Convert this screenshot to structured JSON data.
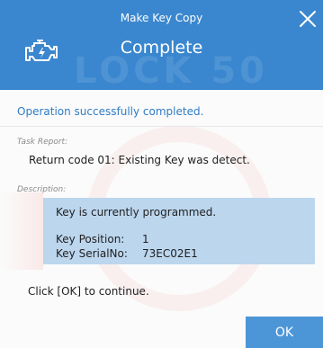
{
  "dialog": {
    "title": "Make Key Copy",
    "subtitle": "Complete",
    "status_prefix": "Operation ",
    "status_highlight": "successfully completed.",
    "task_report_label": "Task Report:",
    "task_report_value": "Return code 01: Existing Key was detect.",
    "description_label": "Description:",
    "description_line": "Key is currently programmed.",
    "key_position_label": "Key Position:",
    "key_position_value": "1",
    "key_serial_label": "Key SerialNo:",
    "key_serial_value": "73EC02E1",
    "continue_text": "Click [OK] to continue.",
    "ok_label": "OK",
    "watermark_text": "LOCK 50"
  },
  "icons": {
    "app_icon": "engine-check-icon",
    "close_icon": "close-icon"
  },
  "colors": {
    "header_bg": "#3a87cf",
    "status_text": "#2f7cc4",
    "description_bg": "#bcd6ee",
    "ok_button_bg": "#4c96d8"
  }
}
